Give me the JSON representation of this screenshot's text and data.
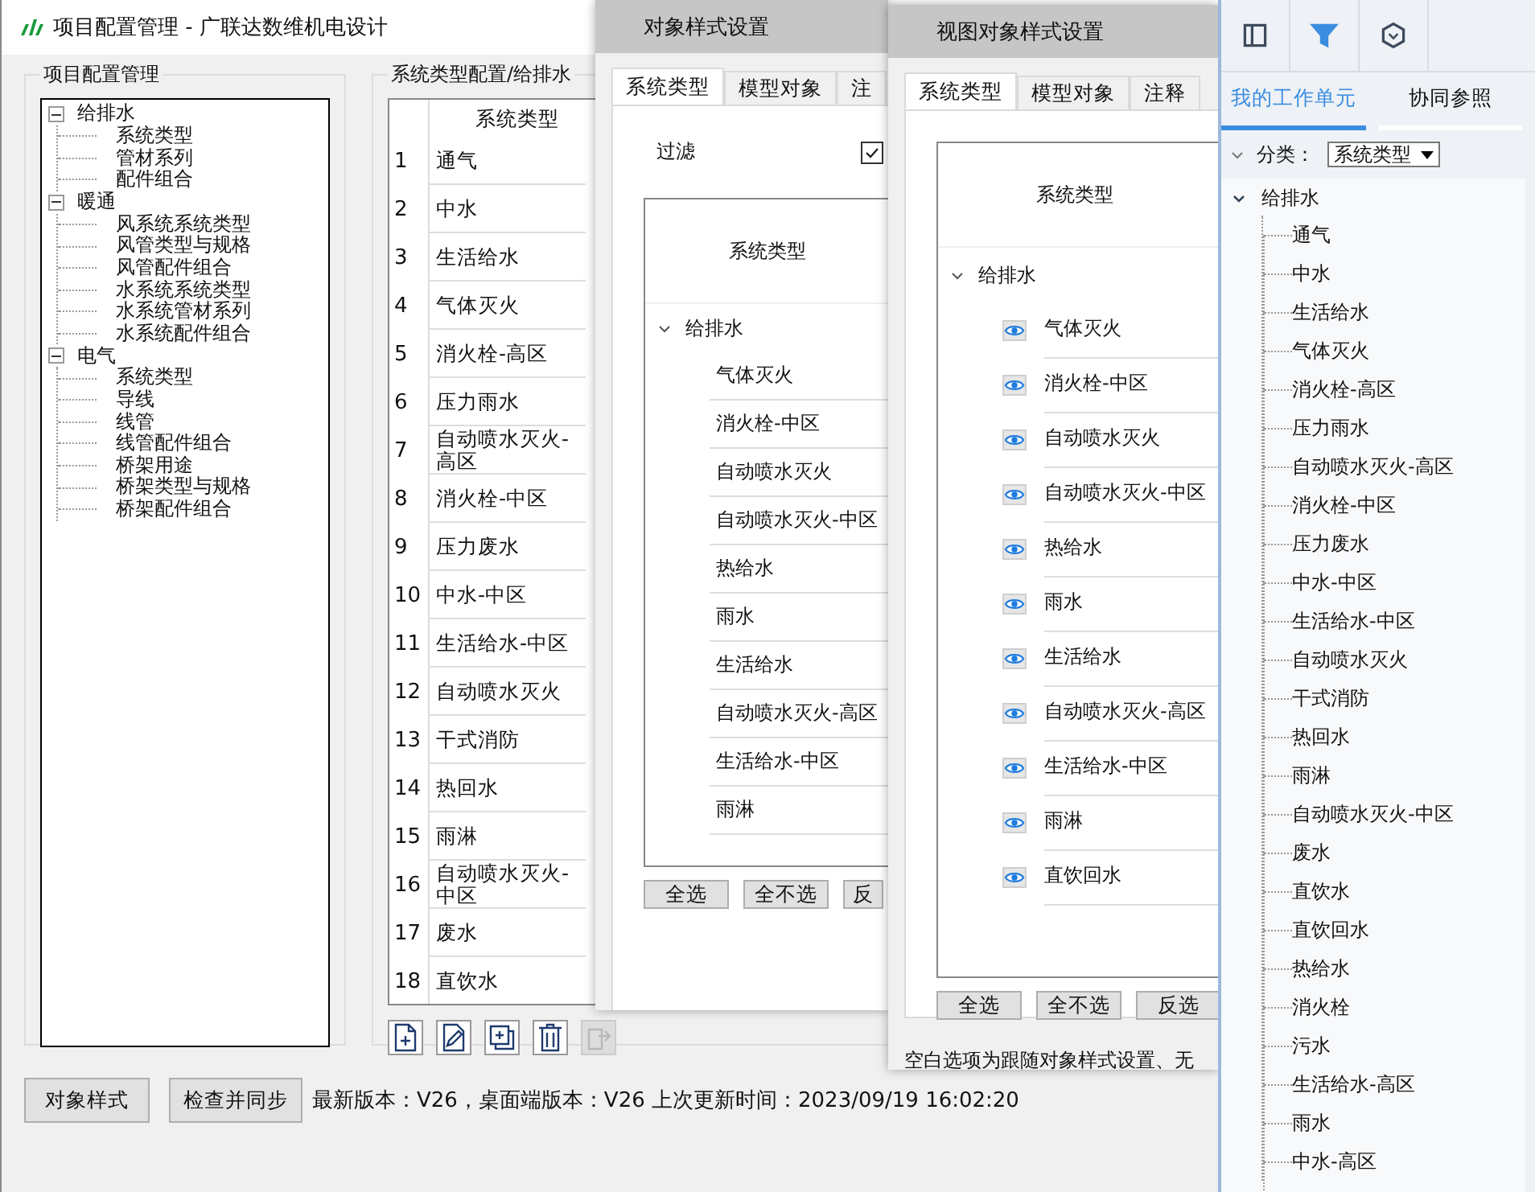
{
  "main_window": {
    "title": "项目配置管理 - 广联达数维机电设计",
    "config_panel": {
      "title": "项目配置管理",
      "tree": [
        {
          "label": "给排水",
          "expanded": true,
          "children": [
            {
              "label": "系统类型"
            },
            {
              "label": "管材系列"
            },
            {
              "label": "配件组合"
            }
          ]
        },
        {
          "label": "暖通",
          "expanded": true,
          "children": [
            {
              "label": "风系统系统类型"
            },
            {
              "label": "风管类型与规格"
            },
            {
              "label": "风管配件组合"
            },
            {
              "label": "水系统系统类型"
            },
            {
              "label": "水系统管材系列"
            },
            {
              "label": "水系统配件组合"
            }
          ]
        },
        {
          "label": "电气",
          "expanded": true,
          "children": [
            {
              "label": "系统类型"
            },
            {
              "label": "导线"
            },
            {
              "label": "线管"
            },
            {
              "label": "线管配件组合"
            },
            {
              "label": "桥架用途"
            },
            {
              "label": "桥架类型与规格"
            },
            {
              "label": "桥架配件组合"
            }
          ]
        }
      ]
    },
    "type_panel": {
      "title": "系统类型配置/给排水",
      "column": "系统类型",
      "rows": [
        {
          "index": "1",
          "name": "通气"
        },
        {
          "index": "2",
          "name": "中水"
        },
        {
          "index": "3",
          "name": "生活给水"
        },
        {
          "index": "4",
          "name": "气体灭火"
        },
        {
          "index": "5",
          "name": "消火栓-高区"
        },
        {
          "index": "6",
          "name": "压力雨水"
        },
        {
          "index": "7",
          "name": "自动喷水灭火-高区"
        },
        {
          "index": "8",
          "name": "消火栓-中区"
        },
        {
          "index": "9",
          "name": "压力废水"
        },
        {
          "index": "10",
          "name": "中水-中区"
        },
        {
          "index": "11",
          "name": "生活给水-中区"
        },
        {
          "index": "12",
          "name": "自动喷水灭火"
        },
        {
          "index": "13",
          "name": "干式消防"
        },
        {
          "index": "14",
          "name": "热回水"
        },
        {
          "index": "15",
          "name": "雨淋"
        },
        {
          "index": "16",
          "name": "自动喷水灭火-中区"
        },
        {
          "index": "17",
          "name": "废水"
        },
        {
          "index": "18",
          "name": "直饮水"
        }
      ],
      "toolbar": [
        {
          "kind": "add",
          "disabled": false
        },
        {
          "kind": "edit",
          "disabled": false
        },
        {
          "kind": "copy",
          "disabled": false
        },
        {
          "kind": "delete",
          "disabled": false
        },
        {
          "kind": "export",
          "disabled": true
        }
      ]
    },
    "buttons": [
      "对象样式",
      "检查并同步"
    ],
    "status": "最新版本：V26，桌面端版本：V26  上次更新时间：2023/09/19 16:02:20"
  },
  "object_style_dialog": {
    "title": "对象样式设置",
    "tabs": [
      {
        "label": "系统类型",
        "selected": true
      },
      {
        "label": "模型对象",
        "selected": false
      },
      {
        "label": "注",
        "selected": false
      }
    ],
    "filter": {
      "label": "过滤",
      "checked": true
    },
    "column": "系统类型",
    "group": "给排水",
    "items": [
      "气体灭火",
      "消火栓-中区",
      "自动喷水灭火",
      "自动喷水灭火-中区",
      "热给水",
      "雨水",
      "生活给水",
      "自动喷水灭火-高区",
      "生活给水-中区",
      "雨淋"
    ],
    "buttons": [
      "全选",
      "全不选",
      "反"
    ]
  },
  "view_style_dialog": {
    "title": "视图对象样式设置",
    "tabs": [
      {
        "label": "系统类型",
        "selected": true
      },
      {
        "label": "模型对象",
        "selected": false
      },
      {
        "label": "注释",
        "selected": false
      }
    ],
    "column": "系统类型",
    "group": "给排水",
    "items": [
      "气体灭火",
      "消火栓-中区",
      "自动喷水灭火",
      "自动喷水灭火-中区",
      "热给水",
      "雨水",
      "生活给水",
      "自动喷水灭火-高区",
      "生活给水-中区",
      "雨淋",
      "直饮回水"
    ],
    "buttons": [
      "全选",
      "全不选",
      "反选"
    ],
    "note": "空白选项为跟随对象样式设置、无"
  },
  "side_panel": {
    "tools": [
      {
        "kind": "panel",
        "selected": false
      },
      {
        "kind": "filter",
        "selected": true
      },
      {
        "kind": "hexagon",
        "selected": false
      }
    ],
    "tabs": [
      {
        "label": "我的工作单元",
        "selected": true
      },
      {
        "label": "协同参照",
        "selected": false
      }
    ],
    "category": {
      "label": "分类：",
      "value": "系统类型"
    },
    "group": "给排水",
    "items": [
      "通气",
      "中水",
      "生活给水",
      "气体灭火",
      "消火栓-高区",
      "压力雨水",
      "自动喷水灭火-高区",
      "消火栓-中区",
      "压力废水",
      "中水-中区",
      "生活给水-中区",
      "自动喷水灭火",
      "干式消防",
      "热回水",
      "雨淋",
      "自动喷水灭火-中区",
      "废水",
      "直饮水",
      "直饮回水",
      "热给水",
      "消火栓",
      "污水",
      "生活给水-高区",
      "雨水",
      "中水-高区"
    ]
  }
}
